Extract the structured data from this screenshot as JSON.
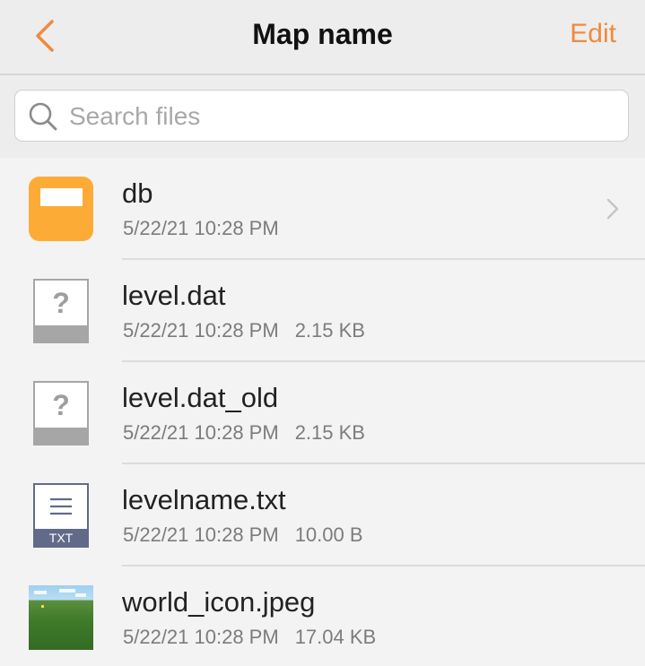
{
  "header": {
    "title": "Map name",
    "edit_label": "Edit",
    "back_icon": "chevron-left-icon"
  },
  "colors": {
    "accent": "#f08a3e",
    "folder": "#fcac36",
    "unknown_file": "#a6a6a6",
    "text_file": "#626a8a",
    "background": "#f3f3f3"
  },
  "search": {
    "placeholder": "Search files",
    "value": ""
  },
  "files": [
    {
      "name": "db",
      "date": "5/22/21 10:28 PM",
      "size": "",
      "icon": "folder-icon",
      "has_chevron": true
    },
    {
      "name": "level.dat",
      "date": "5/22/21 10:28 PM",
      "size": "2.15 KB",
      "icon": "unknown-file-icon",
      "has_chevron": false
    },
    {
      "name": "level.dat_old",
      "date": "5/22/21 10:28 PM",
      "size": "2.15 KB",
      "icon": "unknown-file-icon",
      "has_chevron": false
    },
    {
      "name": "levelname.txt",
      "date": "5/22/21 10:28 PM",
      "size": "10.00 B",
      "icon": "text-file-icon",
      "icon_label": "TXT",
      "has_chevron": false
    },
    {
      "name": "world_icon.jpeg",
      "date": "5/22/21 10:28 PM",
      "size": "17.04 KB",
      "icon": "image-thumbnail",
      "has_chevron": false
    }
  ]
}
